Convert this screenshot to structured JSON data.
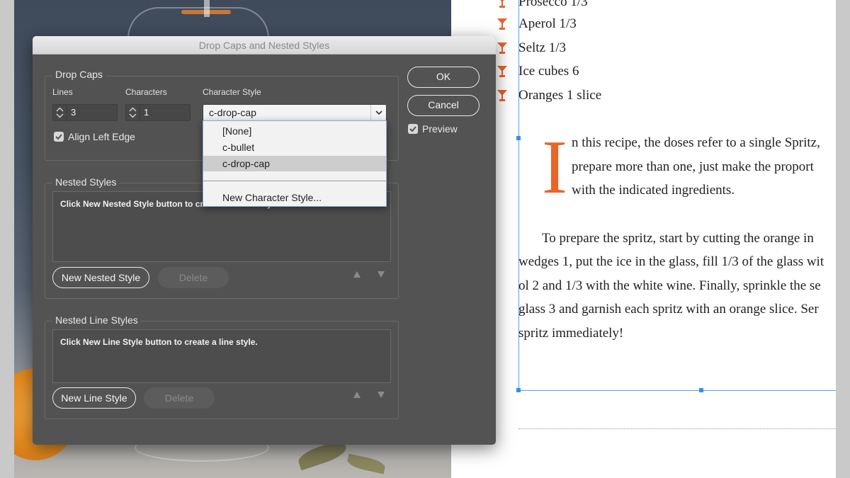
{
  "dialog": {
    "title": "Drop Caps and Nested Styles",
    "drop_caps": {
      "section_title": "Drop Caps",
      "lines_label": "Lines",
      "lines_value": "3",
      "characters_label": "Characters",
      "characters_value": "1",
      "character_style_label": "Character Style",
      "character_style_value": "c-drop-cap",
      "align_left_edge_label": "Align Left Edge",
      "align_left_edge_checked": true
    },
    "character_style_menu": {
      "options": [
        "[None]",
        "c-bullet",
        "c-drop-cap"
      ],
      "selected": "c-drop-cap",
      "new_style_label": "New Character Style..."
    },
    "nested_styles": {
      "section_title": "Nested Styles",
      "hint": "Click New Nested Style button to create a nested style.",
      "new_button": "New Nested Style",
      "delete_button": "Delete"
    },
    "nested_line_styles": {
      "section_title": "Nested Line Styles",
      "hint": "Click New Line Style button to create a line style.",
      "new_button": "New Line Style",
      "delete_button": "Delete"
    },
    "buttons": {
      "ok": "OK",
      "cancel": "Cancel"
    },
    "preview": {
      "label": "Preview",
      "checked": true
    }
  },
  "document": {
    "ingredients": [
      "Prosecco 1/3",
      "Aperol 1/3",
      "Seltz 1/3",
      "Ice cubes 6",
      "Oranges 1 slice"
    ],
    "drop_cap_letter": "I",
    "paragraph1_lines": [
      "n this recipe, the doses refer to a single Spritz,",
      "prepare more than one, just make the proport",
      "with the indicated ingredients."
    ],
    "paragraph2_lines": [
      "To prepare the spritz, start by cutting the orange in",
      "wedges 1, put the ice in the glass, fill 1/3 of the glass wit",
      "ol 2 and 1/3 with the white wine. Finally, sprinkle the se",
      "glass 3 and garnish each spritz with an orange slice. Ser",
      "spritz immediately!"
    ],
    "accent_color": "#e86528"
  }
}
